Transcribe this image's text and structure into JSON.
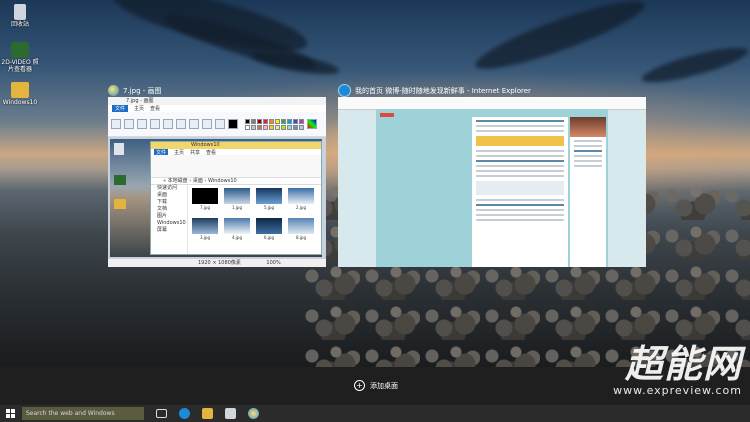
{
  "desktop_icons": [
    {
      "label": "回收站"
    },
    {
      "label": "2D-VIDEO 照片查看器"
    },
    {
      "label": "Windows10"
    }
  ],
  "windows": [
    {
      "title": "7.jpg - 画图",
      "app_icon": "paint-icon",
      "paint": {
        "doc_title": "7.jpg - 画图",
        "tabs": [
          "文件",
          "主页",
          "查看"
        ],
        "status_zoom": "100%",
        "status_size": "1920 × 1080像素",
        "explorer": {
          "title": "Windows10",
          "tabs": [
            "文件",
            "主页",
            "共享",
            "查看"
          ],
          "address": "« 本地磁盘 › 桌面 › Windows10",
          "sidebar": [
            "快速访问",
            "桌面",
            "下载",
            "文档",
            "图片",
            "Windows10",
            "屏幕"
          ],
          "files": [
            "7.jpg",
            "1.jpg",
            "5.jpg",
            "2.jpg",
            "3.jpg",
            "4.jpg",
            "6.jpg",
            "8.jpg"
          ]
        }
      }
    },
    {
      "title": "我的首页 微博-随时随地发现新鲜事 - Internet Explorer",
      "app_icon": "ie-icon"
    }
  ],
  "task_view": {
    "add_desktop_label": "添加桌面"
  },
  "taskbar": {
    "search_placeholder": "Search the web and Windows",
    "icons": [
      "task-view-icon",
      "ie-icon",
      "file-explorer-icon",
      "store-icon",
      "paint-icon"
    ]
  },
  "watermark": {
    "brand": "超能网",
    "url": "www.expreview.com"
  },
  "colors": {
    "taskbar": "#2b2b2b",
    "task_view_bg": "#1f1f1f",
    "start_accent": "#ffffff",
    "paint_file_tab": "#1e6cc5"
  }
}
